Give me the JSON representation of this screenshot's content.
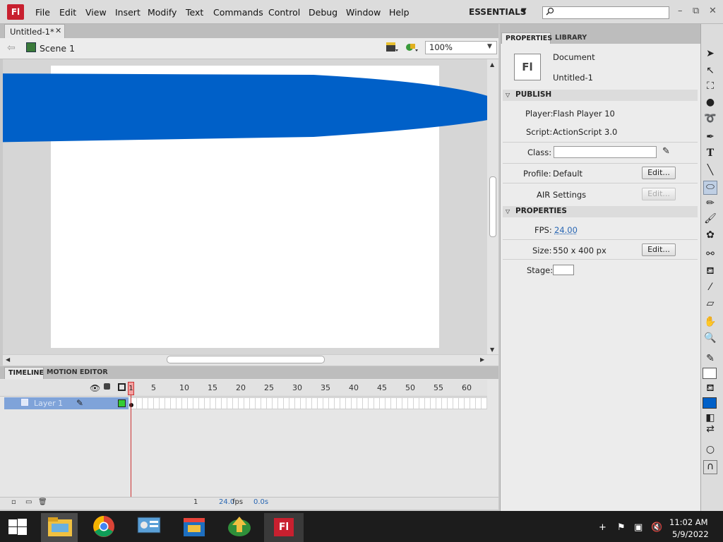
{
  "app": {
    "logo": "Fl"
  },
  "menu": [
    "File",
    "Edit",
    "View",
    "Insert",
    "Modify",
    "Text",
    "Commands",
    "Control",
    "Debug",
    "Window",
    "Help"
  ],
  "workspace": "ESSENTIALS",
  "search": {
    "placeholder": ""
  },
  "document_tab": {
    "label": "Untitled-1*"
  },
  "edit_bar": {
    "scene": "Scene 1",
    "zoom": "100%"
  },
  "stage": {
    "shape_color": "#0060c8",
    "stage_color": "#ffffff"
  },
  "timeline": {
    "tabs": [
      "TIMELINE",
      "MOTION EDITOR"
    ],
    "frame_numbers": [
      "1",
      "5",
      "10",
      "15",
      "20",
      "25",
      "30",
      "35",
      "40",
      "45",
      "50",
      "55",
      "60"
    ],
    "layer": "Layer 1",
    "current_frame": "1",
    "fps": "24.0",
    "fps_unit": "fps",
    "time": "0.0s"
  },
  "panel": {
    "tabs": [
      "PROPERTIES",
      "LIBRARY"
    ],
    "doc_type": "Document",
    "doc_name": "Untitled-1",
    "publish_header": "PUBLISH",
    "player_label": "Player:",
    "player_value": "Flash Player 10",
    "script_label": "Script:",
    "script_value": "ActionScript 3.0",
    "class_label": "Class:",
    "profile_label": "Profile:",
    "profile_value": "Default",
    "edit_label": "Edit...",
    "air_label": "AIR",
    "air_settings": "Settings",
    "properties_header": "PROPERTIES",
    "fps_label": "FPS:",
    "fps_value": "24.00",
    "size_label": "Size:",
    "size_value": "550 x 400 px",
    "stage_label": "Stage:"
  },
  "taskbar": {
    "time": "11:02 AM",
    "date": "5/9/2022"
  }
}
